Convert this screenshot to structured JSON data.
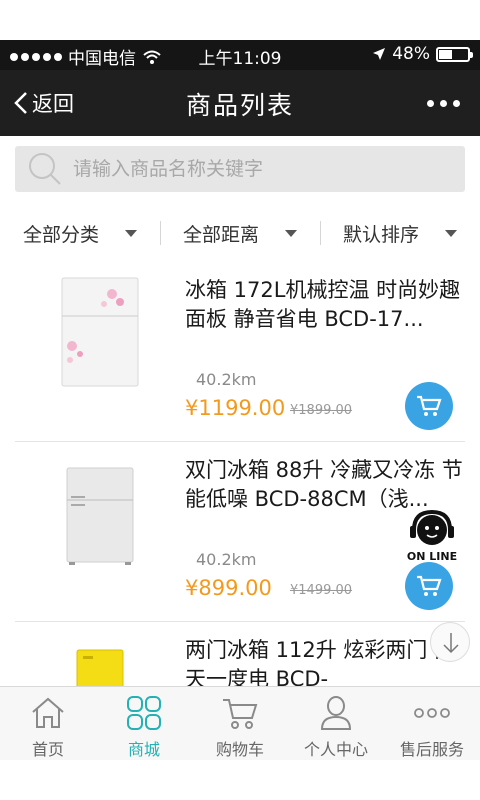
{
  "status_bar": {
    "carrier": "中国电信",
    "time": "上午11:09",
    "battery": "48%",
    "battery_level": 0.48
  },
  "nav": {
    "back_label": "返回",
    "title": "商品列表"
  },
  "search": {
    "placeholder": "请输入商品名称关键字"
  },
  "filters": [
    {
      "label": "全部分类"
    },
    {
      "label": "全部距离"
    },
    {
      "label": "默认排序"
    }
  ],
  "products": [
    {
      "name": "冰箱 172L机械控温 时尚妙趣面板 静音省电 BCD-17...",
      "distance": "40.2km",
      "price": "¥1199.00",
      "old_price": "¥1899.00"
    },
    {
      "name": "双门冰箱 88升 冷藏又冷冻 节能低噪 BCD-88CM（浅...",
      "distance": "40.2km",
      "price": "¥899.00",
      "old_price": "¥1499.00"
    },
    {
      "name": "两门冰箱 112升 炫彩两门 两天一度电 BCD-",
      "distance": "",
      "price": "",
      "old_price": ""
    }
  ],
  "online_label": "ON LINE",
  "tabs": [
    {
      "label": "首页",
      "icon": "home-icon"
    },
    {
      "label": "商城",
      "icon": "grid-icon",
      "active": true
    },
    {
      "label": "购物车",
      "icon": "cart-icon"
    },
    {
      "label": "个人中心",
      "icon": "user-icon"
    },
    {
      "label": "售后服务",
      "icon": "more-icon"
    }
  ],
  "colors": {
    "accent": "#24b1b4",
    "price": "#f39a1e",
    "cart_button": "#3aa3e3",
    "nav_bg": "#1f1f1f"
  }
}
